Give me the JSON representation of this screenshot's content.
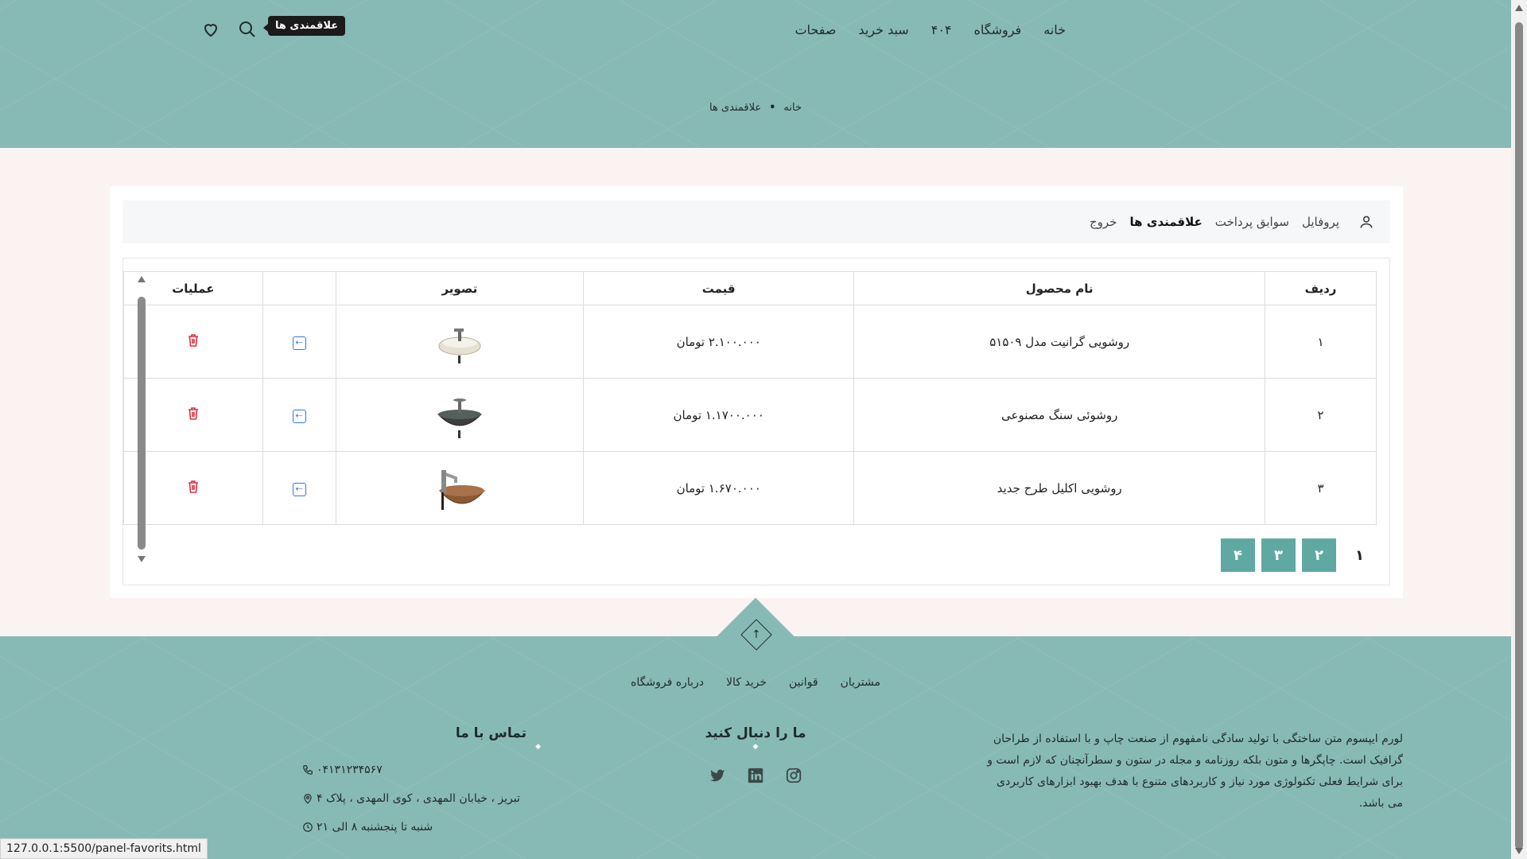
{
  "header": {
    "nav": [
      {
        "label": "خانه"
      },
      {
        "label": "فروشگاه"
      },
      {
        "label": "۴۰۴"
      },
      {
        "label": "سبد خرید"
      },
      {
        "label": "صفحات"
      }
    ],
    "tooltip": "علاقمندی ها",
    "breadcrumb": {
      "home": "خانه",
      "current": "علاقمندی ها",
      "separator": "•"
    }
  },
  "panel": {
    "tabs": [
      {
        "label": "پروفایل"
      },
      {
        "label": "سوابق پرداخت"
      },
      {
        "label": "علاقمندی ها"
      },
      {
        "label": "خروج"
      }
    ],
    "table": {
      "headers": [
        "ردیف",
        "نام محصول",
        "قیمت",
        "تصویر",
        "",
        "عملیات"
      ],
      "rows": [
        {
          "index": "۱",
          "name": "روشویی گرانیت مدل ۵۱۵۰۹",
          "price": "۲.۱۰۰.۰۰۰ تومان"
        },
        {
          "index": "۲",
          "name": "روشوئی سنگ مصنوعی",
          "price": "۱.۱۷۰۰.۰۰۰ تومان"
        },
        {
          "index": "۳",
          "name": "روشویی اکلیل طرح جدید",
          "price": "۱.۶۷۰.۰۰۰ تومان"
        }
      ]
    },
    "pagination": [
      "۱",
      "۲",
      "۳",
      "۴"
    ]
  },
  "footer": {
    "links": [
      {
        "label": "مشتریان"
      },
      {
        "label": "قوانین"
      },
      {
        "label": "خرید کالا"
      },
      {
        "label": "درباره فروشگاه"
      }
    ],
    "about": "لورم ایپسوم متن ساختگی با تولید سادگی نامفهوم از صنعت چاپ و با استفاده از طراحان گرافیک است. چاپگرها و متون بلکه روزنامه و مجله در ستون و سطرآنچنان که لازم است و برای شرایط فعلی تکنولوژی مورد نیاز و کاربردهای متنوع با هدف بهبود ابزارهای کاربردی می باشد.",
    "follow_title": "ما را دنبال کنید",
    "contact_title": "تماس با ما",
    "phone": "۰۴۱۳۱۲۳۴۵۶۷",
    "address": "تبریز ، خیابان المهدی ، کوی المهدی ، پلاک ۴",
    "hours": "شنبه تا پنجشنبه ۸ الی ۲۱"
  },
  "status_url": "127.0.0.1:5500/panel-favorits.html",
  "colors": {
    "teal": "#88bab5",
    "page_button": "#5fa9a2",
    "trash": "#e0303a",
    "arrow": "#2f7bd8"
  }
}
